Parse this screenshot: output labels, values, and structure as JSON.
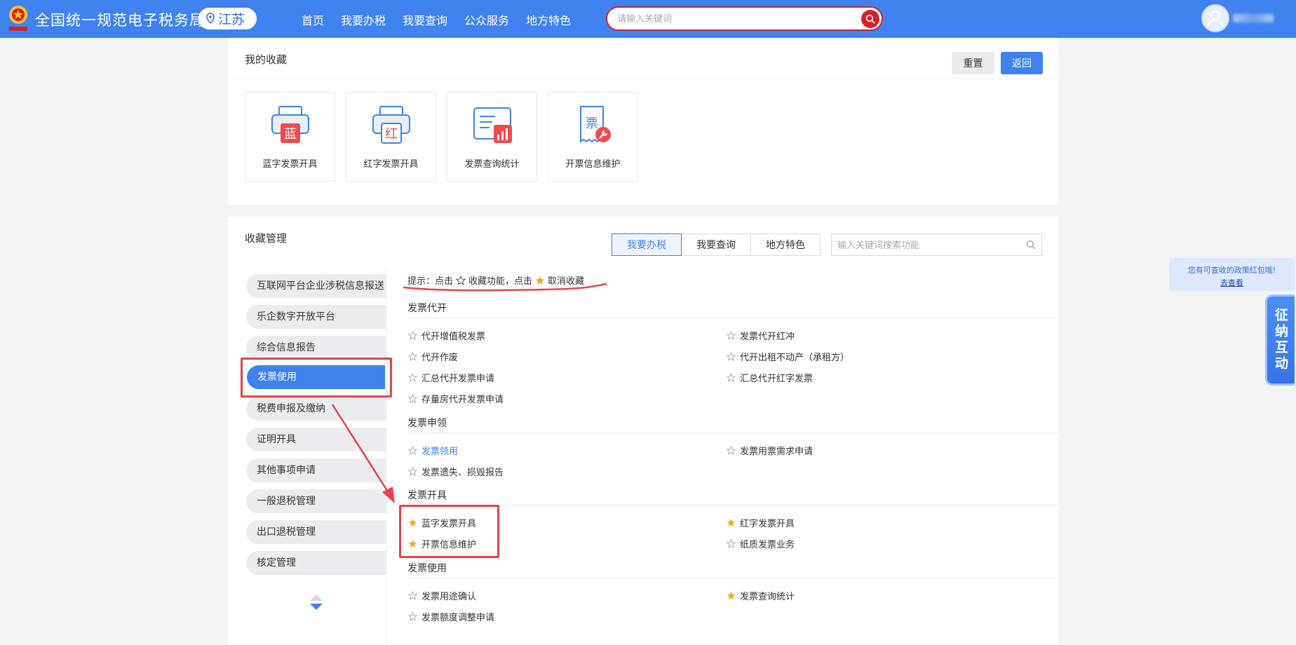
{
  "header": {
    "title": "全国统一规范电子税务局",
    "region": "江苏",
    "nav": [
      "首页",
      "我要办税",
      "我要查询",
      "公众服务",
      "地方特色"
    ],
    "search_placeholder": "请输入关键词"
  },
  "favorites": {
    "title": "我的收藏",
    "reset_label": "重置",
    "back_label": "返回",
    "cards": [
      {
        "label": "蓝字发票开具",
        "icon": "blue-invoice-printer-icon",
        "glyph": "蓝"
      },
      {
        "label": "红字发票开具",
        "icon": "red-invoice-printer-icon",
        "glyph": "红"
      },
      {
        "label": "发票查询统计",
        "icon": "invoice-stats-icon"
      },
      {
        "label": "开票信息维护",
        "icon": "invoice-maintenance-icon",
        "glyph": "票"
      }
    ]
  },
  "manager": {
    "title": "收藏管理",
    "tabs": [
      "我要办税",
      "我要查询",
      "地方特色"
    ],
    "search_placeholder": "输入关键词搜索功能",
    "sidebar": [
      "互联网平台企业涉税信息报送",
      "乐企数字开放平台",
      "综合信息报告",
      "发票使用",
      "税费申报及缴纳",
      "证明开具",
      "其他事项申请",
      "一般退税管理",
      "出口退税管理",
      "核定管理"
    ],
    "hint": {
      "prefix": "提示：点击",
      "mid": "收藏功能，点击",
      "suffix": "取消收藏"
    },
    "sections": [
      {
        "title": "发票代开",
        "items": [
          {
            "label": "代开增值税发票",
            "fav": false
          },
          {
            "label": "发票代开红冲",
            "fav": false
          },
          {
            "label": "代开作废",
            "fav": false
          },
          {
            "label": "代开出租不动产（承租方）",
            "fav": false
          },
          {
            "label": "汇总代开发票申请",
            "fav": false
          },
          {
            "label": "汇总代开红字发票",
            "fav": false
          },
          {
            "label": "存量房代开发票申请",
            "fav": false
          }
        ]
      },
      {
        "title": "发票申领",
        "items": [
          {
            "label": "发票领用",
            "fav": false
          },
          {
            "label": "发票用票需求申请",
            "fav": false
          },
          {
            "label": "发票遗失、损毁报告",
            "fav": false
          }
        ]
      },
      {
        "title": "发票开具",
        "items": [
          {
            "label": "蓝字发票开具",
            "fav": true
          },
          {
            "label": "红字发票开具",
            "fav": true
          },
          {
            "label": "开票信息维护",
            "fav": true
          },
          {
            "label": "纸质发票业务",
            "fav": false
          }
        ]
      },
      {
        "title": "发票使用",
        "items": [
          {
            "label": "发票用途确认",
            "fav": false
          },
          {
            "label": "发票查询统计",
            "fav": true
          },
          {
            "label": "发票额度调整申请",
            "fav": false
          }
        ]
      }
    ]
  },
  "float": {
    "tip": "您有可查收的政策红包哦!",
    "tip_link": "去查看",
    "interact": "征纳互动"
  },
  "colors": {
    "brand_blue": "#3f82f0",
    "brand_red": "#d8202a",
    "star_gold": "#f5a623",
    "annotation_red": "#e8424a"
  }
}
